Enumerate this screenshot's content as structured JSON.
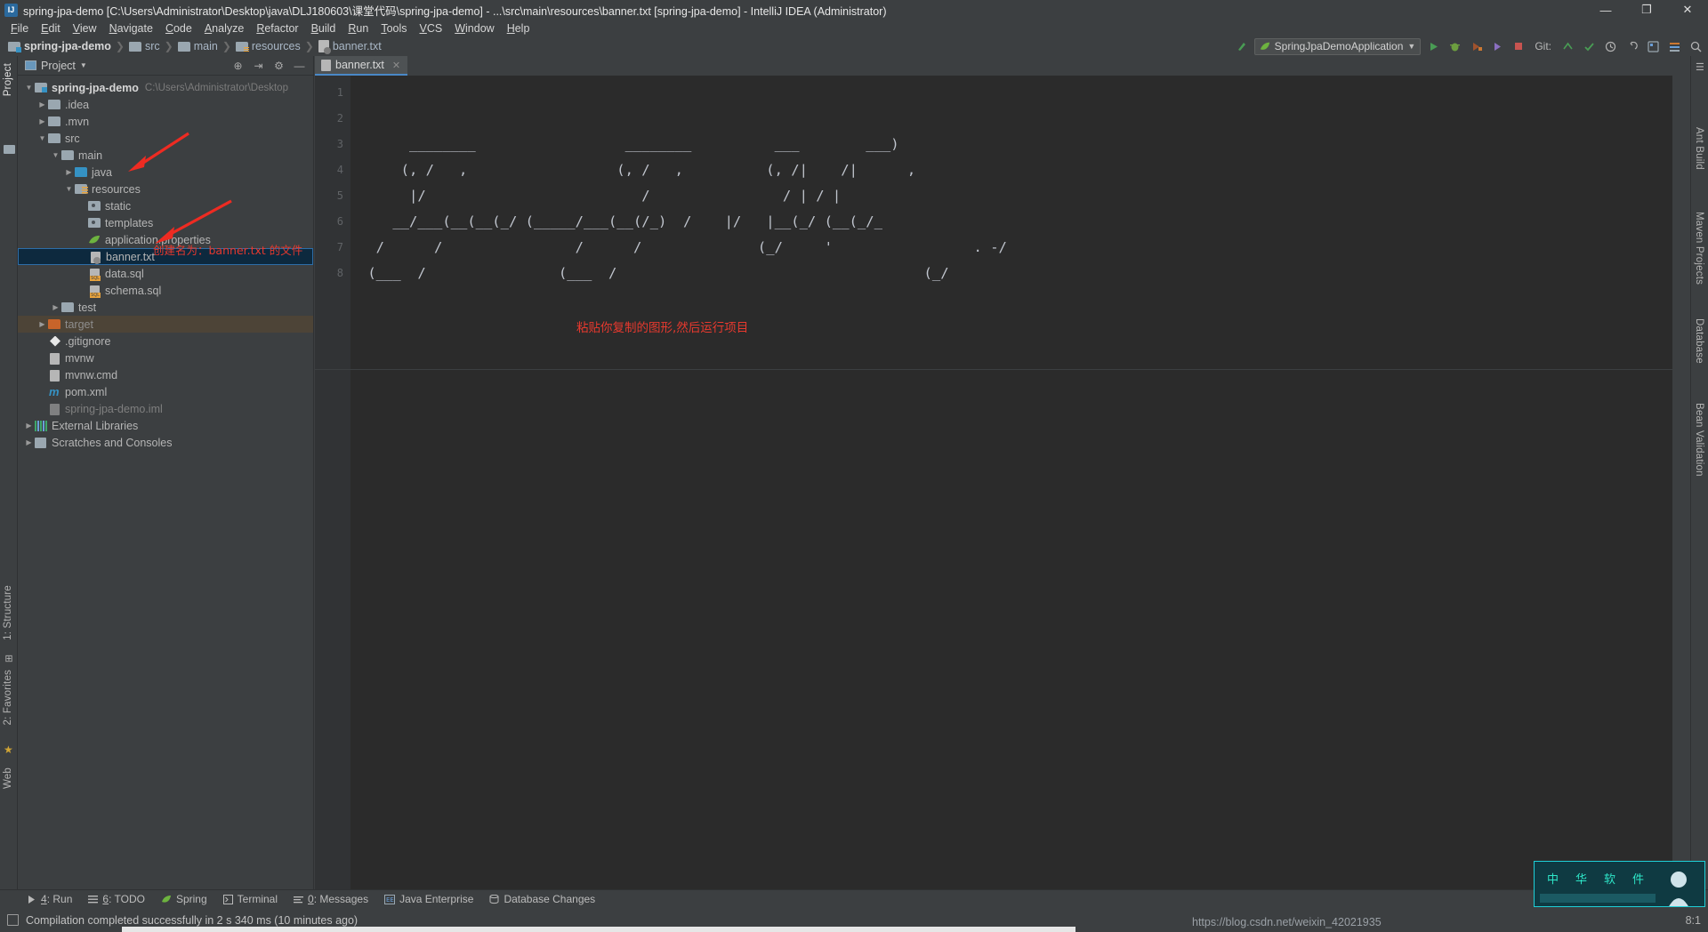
{
  "window": {
    "title": "spring-jpa-demo [C:\\Users\\Administrator\\Desktop\\java\\DLJ180603\\课堂代码\\spring-jpa-demo] - ...\\src\\main\\resources\\banner.txt [spring-jpa-demo] - IntelliJ IDEA (Administrator)",
    "minimize": "—",
    "maximize": "❐",
    "close": "✕",
    "app_icon": "intellij-idea-icon"
  },
  "menu": [
    {
      "label": "File"
    },
    {
      "label": "Edit"
    },
    {
      "label": "View"
    },
    {
      "label": "Navigate"
    },
    {
      "label": "Code"
    },
    {
      "label": "Analyze"
    },
    {
      "label": "Refactor"
    },
    {
      "label": "Build"
    },
    {
      "label": "Run"
    },
    {
      "label": "Tools"
    },
    {
      "label": "VCS"
    },
    {
      "label": "Window"
    },
    {
      "label": "Help"
    }
  ],
  "breadcrumbs": [
    {
      "label": "spring-jpa-demo",
      "icon": "module-folder-icon"
    },
    {
      "label": "src",
      "icon": "folder-icon"
    },
    {
      "label": "main",
      "icon": "folder-icon"
    },
    {
      "label": "resources",
      "icon": "resources-folder-icon"
    },
    {
      "label": "banner.txt",
      "icon": "text-file-icon"
    }
  ],
  "toolbar": {
    "run_config": "SpringJpaDemoApplication",
    "git_label": "Git:",
    "icons": [
      "build-icon",
      "run-icon",
      "debug-icon",
      "coverage-icon",
      "profile-icon",
      "stop-icon",
      "update-project-icon",
      "commit-icon",
      "history-icon",
      "rollback-icon",
      "search-everywhere-icon",
      "settings-icon",
      "project-structure-icon",
      "search-icon"
    ]
  },
  "left_tool_strip": [
    {
      "label": "Project",
      "selected": true
    },
    {
      "label": "1: Structure",
      "selected": false
    },
    {
      "label": "2: Favorites",
      "selected": false
    },
    {
      "label": "Web",
      "selected": false
    }
  ],
  "right_tool_strip": [
    {
      "label": "Ant Build"
    },
    {
      "label": "Maven Projects"
    },
    {
      "label": "Database"
    },
    {
      "label": "Bean Validation"
    }
  ],
  "project_panel": {
    "title": "Project",
    "dropdown_icon": "chevron-down-icon",
    "tools": [
      "target-icon",
      "collapse-all-icon",
      "hide-icon"
    ],
    "tree": [
      {
        "depth": 0,
        "twist": "▼",
        "label": "spring-jpa-demo",
        "path": "C:\\Users\\Administrator\\Desktop",
        "icon": "module-folder-icon",
        "bold": true
      },
      {
        "depth": 1,
        "twist": "▶",
        "label": ".idea",
        "icon": "folder-icon"
      },
      {
        "depth": 1,
        "twist": "▶",
        "label": ".mvn",
        "icon": "folder-icon"
      },
      {
        "depth": 1,
        "twist": "▼",
        "label": "src",
        "icon": "folder-icon"
      },
      {
        "depth": 2,
        "twist": "▼",
        "label": "main",
        "icon": "folder-icon"
      },
      {
        "depth": 3,
        "twist": "▶",
        "label": "java",
        "icon": "sources-folder-icon"
      },
      {
        "depth": 3,
        "twist": "▼",
        "label": "resources",
        "icon": "resources-folder-icon"
      },
      {
        "depth": 4,
        "twist": "",
        "label": "static",
        "icon": "static-folder-icon"
      },
      {
        "depth": 4,
        "twist": "",
        "label": "templates",
        "icon": "templates-folder-icon"
      },
      {
        "depth": 4,
        "twist": "",
        "label": "application.properties",
        "icon": "spring-properties-icon"
      },
      {
        "depth": 4,
        "twist": "",
        "label": "banner.txt",
        "icon": "text-file-icon",
        "selected": true
      },
      {
        "depth": 4,
        "twist": "",
        "label": "data.sql",
        "icon": "sql-file-icon"
      },
      {
        "depth": 4,
        "twist": "",
        "label": "schema.sql",
        "icon": "sql-file-icon"
      },
      {
        "depth": 2,
        "twist": "▶",
        "label": "test",
        "icon": "folder-icon"
      },
      {
        "depth": 1,
        "twist": "▶",
        "label": "target",
        "icon": "excluded-folder-icon",
        "excluded": true
      },
      {
        "depth": 1,
        "twist": "",
        "label": ".gitignore",
        "icon": "git-file-icon"
      },
      {
        "depth": 1,
        "twist": "",
        "label": "mvnw",
        "icon": "file-icon"
      },
      {
        "depth": 1,
        "twist": "",
        "label": "mvnw.cmd",
        "icon": "file-icon"
      },
      {
        "depth": 1,
        "twist": "",
        "label": "pom.xml",
        "icon": "maven-file-icon"
      },
      {
        "depth": 1,
        "twist": "",
        "label": "spring-jpa-demo.iml",
        "icon": "iml-file-icon",
        "dim": true
      },
      {
        "depth": 0,
        "twist": "▶",
        "label": "External Libraries",
        "icon": "libraries-icon"
      },
      {
        "depth": 0,
        "twist": "▶",
        "label": "Scratches and Consoles",
        "icon": "scratches-icon"
      }
    ]
  },
  "editor": {
    "tab": {
      "label": "banner.txt",
      "icon": "text-file-icon",
      "close": "✕"
    },
    "line_numbers": [
      "1",
      "2",
      "3",
      "4",
      "5",
      "6",
      "7",
      "8"
    ],
    "lines": [
      "",
      "",
      "      ________                  ________          ___        ___)",
      "     (, /   ,                  (, /   ,          (, /|    /|      ,",
      "      |/                          /                / | / |",
      "    __/___(__(__(_/ (_____/___(__(/_)  /    |/   |__(_/ (__(_/_",
      "  /      /                /      /              (_/     '                 . -/",
      " (___  /                (___  /                                     (_/"
    ],
    "annotation": "粘贴你复制的图形,然后运行项目"
  },
  "annotations": {
    "tree_note": "创建名为：banner.txt 的文件",
    "arrow_resources": "red-arrow-icon",
    "arrow_banner": "red-arrow-icon"
  },
  "bottom_tools": [
    {
      "label": "4: Run",
      "shortcut": "4",
      "icon": "run-icon"
    },
    {
      "label": "6: TODO",
      "shortcut": "6",
      "icon": "todo-icon"
    },
    {
      "label": "Spring",
      "icon": "spring-icon"
    },
    {
      "label": "Terminal",
      "icon": "terminal-icon"
    },
    {
      "label": "0: Messages",
      "shortcut": "0",
      "icon": "messages-icon"
    },
    {
      "label": "Java Enterprise",
      "icon": "java-enterprise-icon"
    },
    {
      "label": "Database Changes",
      "icon": "database-changes-icon"
    }
  ],
  "status": {
    "message": "Compilation completed successfully in 2 s 340 ms (10 minutes ago)",
    "caret": "8:1",
    "watermark": "https://blog.csdn.net/weixin_42021935",
    "icon": "event-log-icon"
  },
  "colors": {
    "accent_blue": "#4a88c7",
    "panel_bg": "#3c3f41",
    "editor_bg": "#2b2b2b",
    "selection_bg": "#0d293e",
    "note_red": "#e8392e",
    "arrow_red": "#ee2b22",
    "excluded_bg": "#4d4437"
  }
}
